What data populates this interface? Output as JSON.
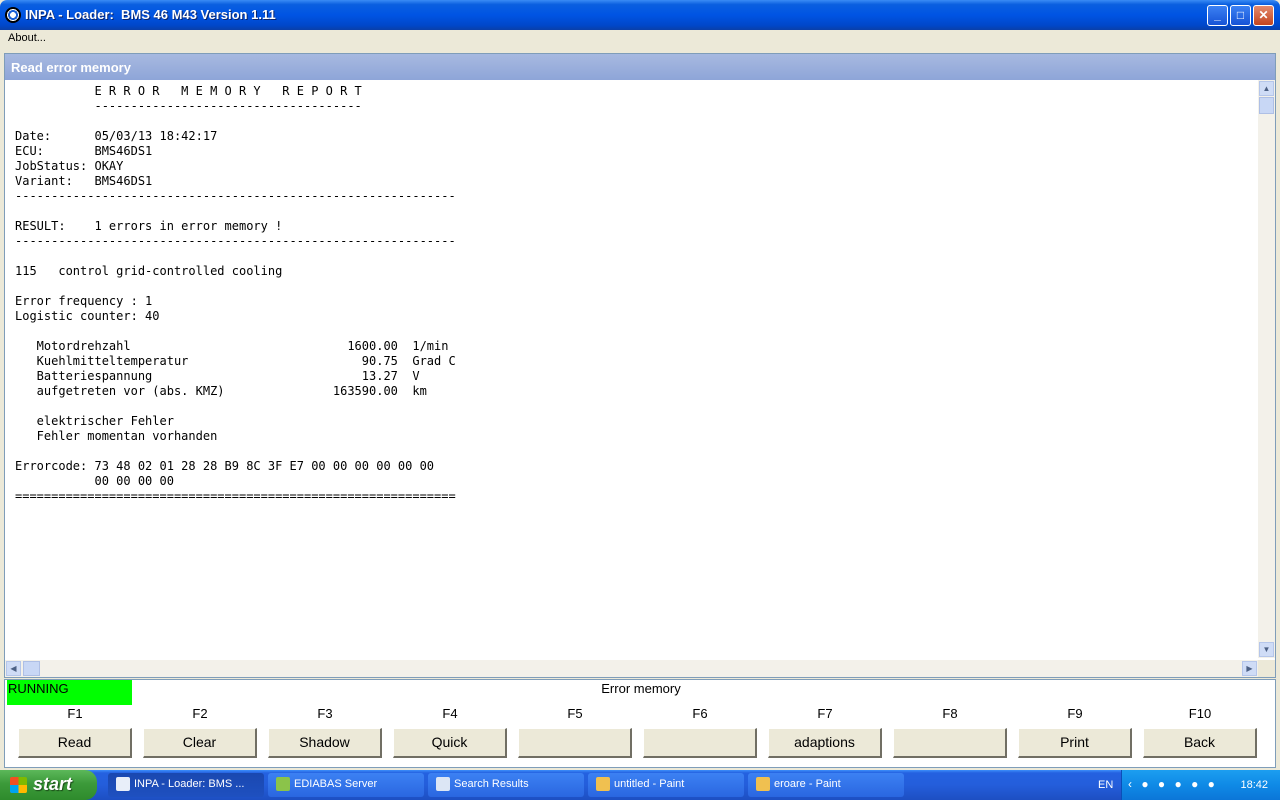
{
  "window": {
    "title": "INPA - Loader:  BMS 46 M43 Version 1.11",
    "min": "_",
    "max": "□",
    "close": "✕"
  },
  "menu": {
    "about": "About..."
  },
  "panel": {
    "title": "Read error memory"
  },
  "report": {
    "lines": [
      "           E R R O R   M E M O R Y   R E P O R T",
      "           -------------------------------------",
      "",
      "Date:      05/03/13 18:42:17",
      "ECU:       BMS46DS1",
      "JobStatus: OKAY",
      "Variant:   BMS46DS1",
      "-------------------------------------------------------------",
      "",
      "RESULT:    1 errors in error memory !",
      "-------------------------------------------------------------",
      "",
      "115   control grid-controlled cooling",
      "",
      "Error frequency : 1",
      "Logistic counter: 40",
      "",
      "   Motordrehzahl                              1600.00  1/min",
      "   Kuehlmitteltemperatur                        90.75  Grad C",
      "   Batteriespannung                             13.27  V",
      "   aufgetreten vor (abs. KMZ)               163590.00  km",
      "",
      "   elektrischer Fehler",
      "   Fehler momentan vorhanden",
      "",
      "Errorcode: 73 48 02 01 28 28 B9 8C 3F E7 00 00 00 00 00 00",
      "           00 00 00 00",
      "============================================================="
    ]
  },
  "scroll": {
    "up": "▲",
    "down": "▼",
    "left": "◀",
    "right": "▶"
  },
  "status": {
    "state": "RUNNING",
    "state_color": "#00ff00",
    "screen_title": "Error memory"
  },
  "function_keys": [
    {
      "key": "F1",
      "label": "Read"
    },
    {
      "key": "F2",
      "label": "Clear"
    },
    {
      "key": "F3",
      "label": "Shadow"
    },
    {
      "key": "F4",
      "label": "Quick"
    },
    {
      "key": "F5",
      "label": ""
    },
    {
      "key": "F6",
      "label": ""
    },
    {
      "key": "F7",
      "label": "adaptions"
    },
    {
      "key": "F8",
      "label": ""
    },
    {
      "key": "F9",
      "label": "Print"
    },
    {
      "key": "F10",
      "label": "Back"
    }
  ],
  "taskbar": {
    "start": "start",
    "tasks": [
      {
        "label": "INPA - Loader:  BMS ...",
        "icon": "bmw-icon",
        "active": true
      },
      {
        "label": "EDIABAS Server",
        "icon": "ediabas-icon",
        "active": false
      },
      {
        "label": "Search Results",
        "icon": "search-results-icon",
        "active": false
      },
      {
        "label": "untitled - Paint",
        "icon": "paint-icon",
        "active": false
      },
      {
        "label": "eroare - Paint",
        "icon": "paint-icon",
        "active": false
      }
    ],
    "language": "EN",
    "clock": "18:42"
  }
}
